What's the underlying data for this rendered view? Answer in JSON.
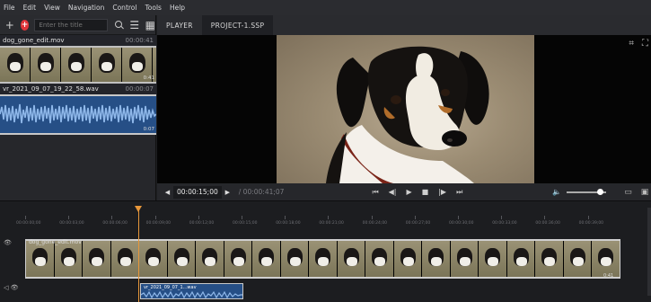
{
  "menu": [
    "File",
    "Edit",
    "View",
    "Navigation",
    "Control",
    "Tools",
    "Help"
  ],
  "library": {
    "search_placeholder": "Enter the title",
    "clips": [
      {
        "name": "dog_gone_edit.mov",
        "duration": "00:00:41",
        "strip_label": "0:41"
      },
      {
        "name": "vr_2021_09_07_19_22_58.wav",
        "duration": "00:00:07",
        "strip_label": "0:07"
      }
    ]
  },
  "tabs": [
    "PLAYER",
    "PROJECT-1.SSP"
  ],
  "transport": {
    "timecode": "00:00:15;00",
    "total": "/ 00:00:41;07",
    "volume_level": 0.85
  },
  "timeline": {
    "ruler_labels": [
      "00:00:00;00",
      "00:00:03;00",
      "00:00:06;00",
      "00:00:09;00",
      "00:00:12;00",
      "00:00:15;00",
      "00:00:18;00",
      "00:00:21;00",
      "00:00:24;00",
      "00:00:27;00",
      "00:00:30;00",
      "00:00:33;00",
      "00:00:36;00",
      "00:00:39;00"
    ],
    "video_clip": {
      "name": "dog_gone_edit.mov",
      "duration": "0:41"
    },
    "audio_clip": {
      "name": "vr_2021_09_07_1...wav"
    }
  },
  "colors": {
    "accent": "#e7973a",
    "audio": "#264f86",
    "record": "#e0353a"
  }
}
